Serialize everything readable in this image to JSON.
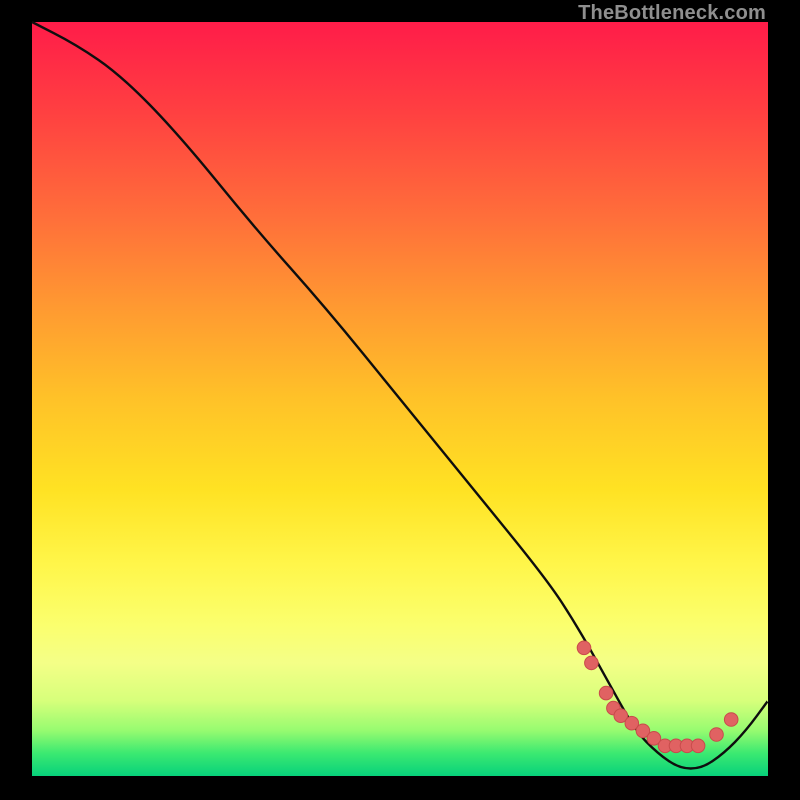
{
  "watermark": "TheBottleneck.com",
  "colors": {
    "curve_stroke": "#0e0e0e",
    "marker_fill": "#e06262",
    "marker_stroke": "#c84b4b"
  },
  "chart_data": {
    "type": "line",
    "title": "",
    "xlabel": "",
    "ylabel": "",
    "xlim": [
      0,
      100
    ],
    "ylim": [
      0,
      100
    ],
    "series": [
      {
        "name": "curve",
        "x": [
          0,
          6,
          12,
          20,
          30,
          40,
          50,
          60,
          70,
          74,
          78,
          82,
          85,
          88,
          91,
          94,
          97,
          100
        ],
        "values": [
          100,
          97,
          93,
          85,
          73,
          62,
          50,
          38,
          26,
          20,
          13,
          6,
          3,
          1,
          1,
          3,
          6,
          10
        ]
      }
    ],
    "markers": {
      "x": [
        75,
        76,
        78,
        79,
        80,
        81.5,
        83,
        84.5,
        86,
        87.5,
        89,
        90.5,
        93,
        95
      ],
      "values": [
        17,
        15,
        11,
        9,
        8,
        7,
        6,
        5,
        4,
        4,
        4,
        4,
        5.5,
        7.5
      ]
    }
  }
}
